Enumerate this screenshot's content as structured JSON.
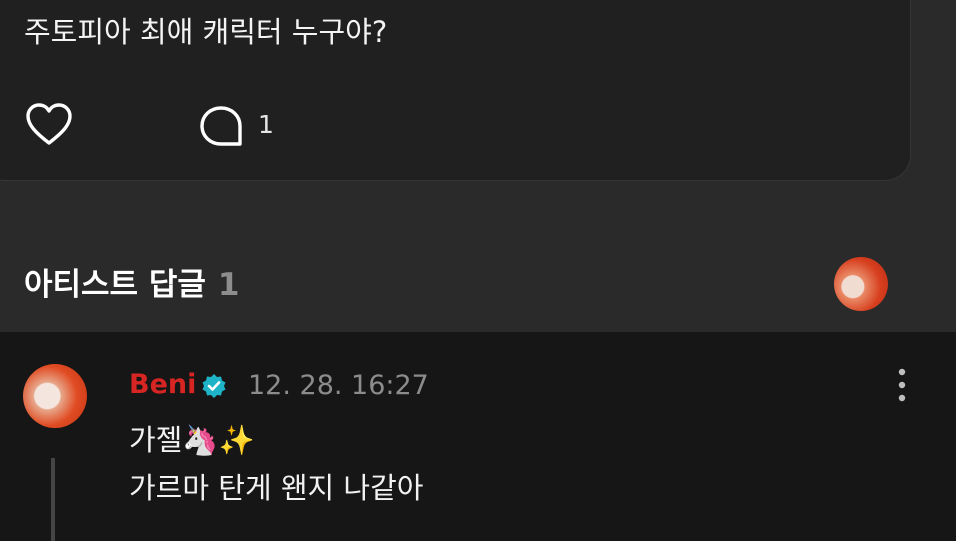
{
  "post": {
    "text": "주토피아 최애 캐릭터 누구야?",
    "comment_count": "1",
    "icons": {
      "like": "heart-icon",
      "comment": "comment-bubble-icon"
    }
  },
  "artist_replies": {
    "title": "아티스트 답글",
    "count": "1",
    "avatar_icon": "artist-avatar"
  },
  "reply": {
    "author": "Beni",
    "timestamp": "12. 28. 16:27",
    "line1": "가젤🦄✨",
    "line2": "가르마 탄게 왠지 나같아",
    "icons": {
      "verified": "verified-badge-icon",
      "more": "more-vertical-icon"
    },
    "colors": {
      "author": "#d62522",
      "verified": "#1fb3c7"
    }
  }
}
